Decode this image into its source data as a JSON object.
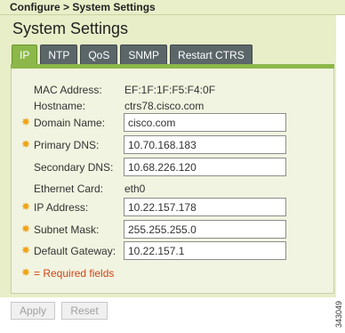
{
  "breadcrumb": "Configure > System Settings",
  "title": "System Settings",
  "tabs": [
    {
      "label": "IP",
      "active": true
    },
    {
      "label": "NTP"
    },
    {
      "label": "QoS"
    },
    {
      "label": "SNMP"
    },
    {
      "label": "Restart CTRS"
    }
  ],
  "fields": {
    "mac": {
      "label": "MAC Address:",
      "value": "EF:1F:1F:F5:F4:0F"
    },
    "hostname": {
      "label": "Hostname:",
      "value": "ctrs78.cisco.com"
    },
    "domain": {
      "label": "Domain Name:",
      "value": "cisco.com"
    },
    "primary_dns": {
      "label": "Primary DNS:",
      "value": "10.70.168.183"
    },
    "secondary_dns": {
      "label": "Secondary DNS:",
      "value": "10.68.226.120"
    },
    "ethernet": {
      "label": "Ethernet Card:",
      "value": "eth0"
    },
    "ip": {
      "label": "IP Address:",
      "value": "10.22.157.178"
    },
    "subnet": {
      "label": "Subnet Mask:",
      "value": "255.255.255.0"
    },
    "gateway": {
      "label": "Default Gateway:",
      "value": "10.22.157.1"
    }
  },
  "required_note": "= Required fields",
  "buttons": {
    "apply": "Apply",
    "reset": "Reset"
  },
  "figure_id": "343049",
  "colors": {
    "accent": "#8cb84a",
    "tab_inactive": "#5b6669",
    "required_star": "#f0a418",
    "required_text": "#d0441a"
  },
  "icons": {
    "required": "asterisk-star-icon"
  }
}
